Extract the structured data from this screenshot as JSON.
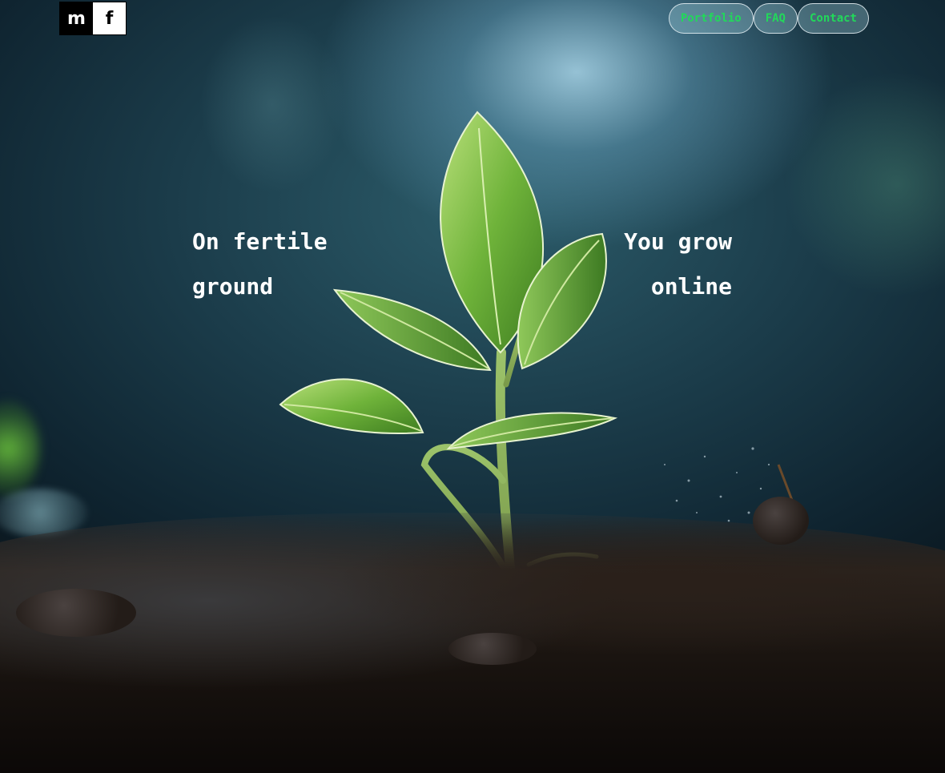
{
  "header": {
    "logo": {
      "letter_1": "m",
      "letter_2": "f"
    },
    "nav": [
      {
        "label": "Portfolio"
      },
      {
        "label": "FAQ"
      },
      {
        "label": "Contact"
      }
    ]
  },
  "hero": {
    "left_heading": {
      "line_1": "On fertile",
      "line_2": "ground"
    },
    "right_heading": {
      "line_1": "You grow",
      "line_2": "online"
    },
    "background_image": "seedling-in-soil"
  },
  "colors": {
    "nav_text": "#22d85a",
    "heading_text": "#ffffff",
    "logo_dark": "#000000",
    "logo_light": "#ffffff"
  }
}
